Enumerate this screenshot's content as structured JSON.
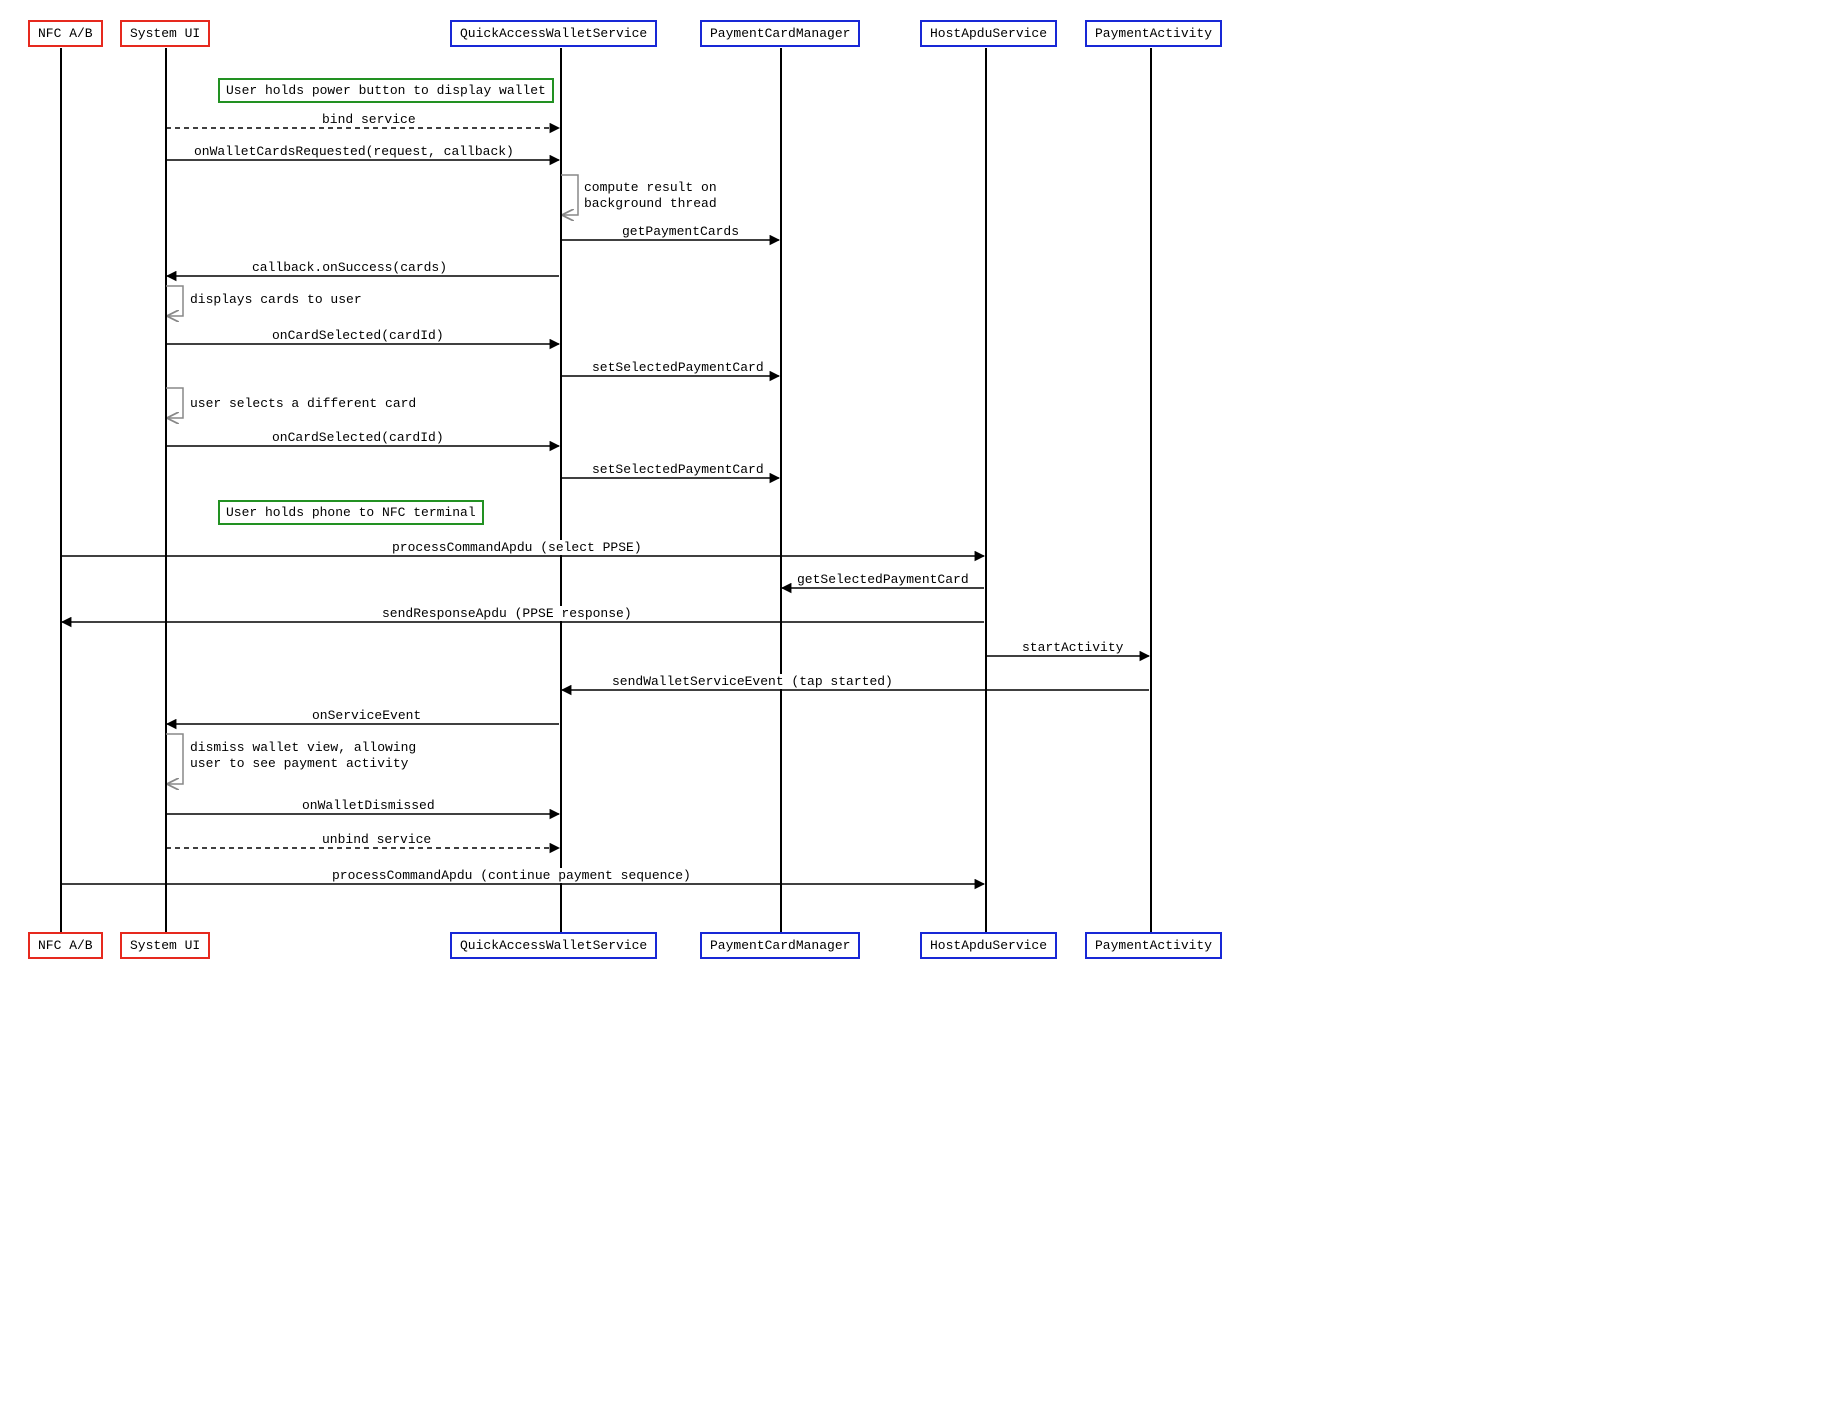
{
  "participants": {
    "nfc": "NFC A/B",
    "sysui": "System UI",
    "qaws": "QuickAccessWalletService",
    "pcm": "PaymentCardManager",
    "has": "HostApduService",
    "pa": "PaymentActivity"
  },
  "notes": {
    "n1": "User holds power button to display wallet",
    "n2": "User holds phone to NFC terminal"
  },
  "selfmsgs": {
    "s1": "compute result on\nbackground thread",
    "s2": "displays cards to user",
    "s3": "user selects a different card",
    "s4": "dismiss wallet view, allowing\nuser to see payment activity"
  },
  "messages": {
    "m1": "bind service",
    "m2": "onWalletCardsRequested(request, callback)",
    "m3": "getPaymentCards",
    "m4": "callback.onSuccess(cards)",
    "m5": "onCardSelected(cardId)",
    "m6": "setSelectedPaymentCard",
    "m7": "onCardSelected(cardId)",
    "m8": "setSelectedPaymentCard",
    "m9": "processCommandApdu (select PPSE)",
    "m10": "getSelectedPaymentCard",
    "m11": "sendResponseApdu (PPSE response)",
    "m12": "startActivity",
    "m13": "sendWalletServiceEvent (tap started)",
    "m14": "onServiceEvent",
    "m15": "onWalletDismissed",
    "m16": "unbind service",
    "m17": "processCommandApdu (continue payment sequence)"
  }
}
